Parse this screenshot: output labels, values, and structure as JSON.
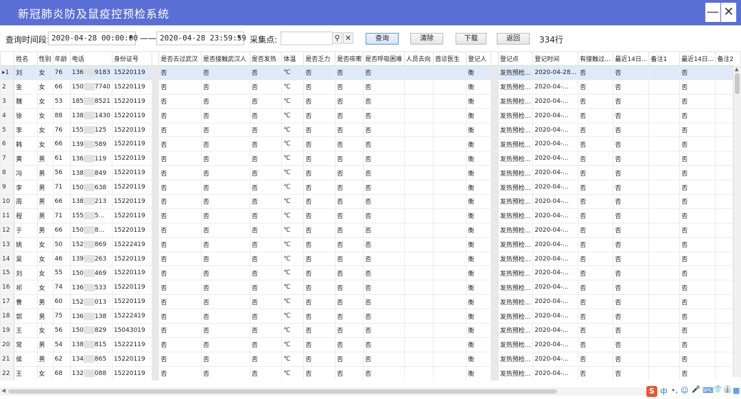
{
  "window": {
    "title": "新冠肺炎防及鼠疫控预检系统",
    "minimize_label": "—",
    "close_label": "✕"
  },
  "toolbar": {
    "time_label": "查询时间段:",
    "start_time": "2020-04-28 00:00:00",
    "separator": "——",
    "end_time": "2020-04-28 23:59:59",
    "site_label": "采集点:",
    "site_value": "",
    "query_label": "查询",
    "clear_label": "清除",
    "download_label": "下载",
    "back_label": "返回",
    "row_count": "334行"
  },
  "grid": {
    "columns": [
      "",
      "姓名",
      "性别",
      "年龄",
      "电话",
      "身份证号",
      "",
      "是否去过武汉",
      "是否接触武汉人",
      "是否发热",
      "体温",
      "是否乏力",
      "是否咳嗽",
      "是否呼吸困难",
      "人员去向",
      "首诊医生",
      "登记人",
      "",
      "登记点",
      "登记时间",
      "有接触过...",
      "最近14日...",
      "备注1",
      "最近14日...",
      "备注2"
    ],
    "rows": [
      {
        "n": "1",
        "name": "刘",
        "sex": "女",
        "age": "76",
        "phone": "136",
        "phone_tail": "9183",
        "id": "15220119",
        "wuhan": "否",
        "contact": "否",
        "fever": "否",
        "temp": "℃",
        "fatigue": "否",
        "cough": "否",
        "breath": "否",
        "reg": "衡",
        "site": "发热预检...",
        "time": "2020-04-28...",
        "c1": "否",
        "c2": "否",
        "c3": "否"
      },
      {
        "n": "2",
        "name": "金",
        "sex": "女",
        "age": "66",
        "phone": "150",
        "phone_tail": "7740",
        "id": "15220119",
        "wuhan": "否",
        "contact": "否",
        "fever": "否",
        "temp": "℃",
        "fatigue": "否",
        "cough": "否",
        "breath": "否",
        "reg": "衡",
        "site": "发热预检...",
        "time": "2020-04-...",
        "c1": "否",
        "c2": "否",
        "c3": "否"
      },
      {
        "n": "3",
        "name": "魏",
        "sex": "女",
        "age": "53",
        "phone": "185",
        "phone_tail": "8521",
        "id": "15220119",
        "wuhan": "否",
        "contact": "否",
        "fever": "否",
        "temp": "℃",
        "fatigue": "否",
        "cough": "否",
        "breath": "否",
        "reg": "衡",
        "site": "发热预检...",
        "time": "2020-04-...",
        "c1": "否",
        "c2": "否",
        "c3": "否"
      },
      {
        "n": "4",
        "name": "徐",
        "sex": "女",
        "age": "88",
        "phone": "138",
        "phone_tail": "1430",
        "id": "15220119",
        "wuhan": "否",
        "contact": "否",
        "fever": "否",
        "temp": "℃",
        "fatigue": "否",
        "cough": "否",
        "breath": "否",
        "reg": "衡",
        "site": "发热预检...",
        "time": "2020-04-...",
        "c1": "否",
        "c2": "否",
        "c3": "否"
      },
      {
        "n": "5",
        "name": "李",
        "sex": "女",
        "age": "76",
        "phone": "155",
        "phone_tail": "125",
        "id": "15220119",
        "wuhan": "否",
        "contact": "否",
        "fever": "否",
        "temp": "℃",
        "fatigue": "否",
        "cough": "否",
        "breath": "否",
        "reg": "衡",
        "site": "发热预检...",
        "time": "2020-04-...",
        "c1": "否",
        "c2": "否",
        "c3": "否"
      },
      {
        "n": "6",
        "name": "韩",
        "sex": "女",
        "age": "66",
        "phone": "139",
        "phone_tail": "589",
        "id": "15220119",
        "wuhan": "否",
        "contact": "否",
        "fever": "否",
        "temp": "℃",
        "fatigue": "否",
        "cough": "否",
        "breath": "否",
        "reg": "衡",
        "site": "发热预检...",
        "time": "2020-04-...",
        "c1": "否",
        "c2": "否",
        "c3": "否"
      },
      {
        "n": "7",
        "name": "黄",
        "sex": "男",
        "age": "61",
        "phone": "136",
        "phone_tail": "119",
        "id": "15220119",
        "wuhan": "否",
        "contact": "否",
        "fever": "否",
        "temp": "℃",
        "fatigue": "否",
        "cough": "否",
        "breath": "否",
        "reg": "衡",
        "site": "发热预检...",
        "time": "2020-04-...",
        "c1": "否",
        "c2": "否",
        "c3": "否"
      },
      {
        "n": "8",
        "name": "冯",
        "sex": "男",
        "age": "56",
        "phone": "138",
        "phone_tail": "849",
        "id": "15220119",
        "wuhan": "否",
        "contact": "否",
        "fever": "否",
        "temp": "℃",
        "fatigue": "否",
        "cough": "否",
        "breath": "否",
        "reg": "衡",
        "site": "发热预检...",
        "time": "2020-04-...",
        "c1": "否",
        "c2": "否",
        "c3": "否"
      },
      {
        "n": "9",
        "name": "李",
        "sex": "男",
        "age": "71",
        "phone": "150",
        "phone_tail": "638",
        "id": "15220119",
        "wuhan": "否",
        "contact": "否",
        "fever": "否",
        "temp": "℃",
        "fatigue": "否",
        "cough": "否",
        "breath": "否",
        "reg": "衡",
        "site": "发热预检...",
        "time": "2020-04-...",
        "c1": "否",
        "c2": "否",
        "c3": "否"
      },
      {
        "n": "10",
        "name": "周",
        "sex": "男",
        "age": "66",
        "phone": "138",
        "phone_tail": "213",
        "id": "15220119",
        "wuhan": "否",
        "contact": "否",
        "fever": "否",
        "temp": "℃",
        "fatigue": "否",
        "cough": "否",
        "breath": "否",
        "reg": "衡",
        "site": "发热预检...",
        "time": "2020-04-...",
        "c1": "否",
        "c2": "否",
        "c3": "否"
      },
      {
        "n": "11",
        "name": "程",
        "sex": "男",
        "age": "71",
        "phone": "155",
        "phone_tail": "5...",
        "id": "15220119",
        "wuhan": "否",
        "contact": "否",
        "fever": "否",
        "temp": "℃",
        "fatigue": "否",
        "cough": "否",
        "breath": "否",
        "reg": "衡",
        "site": "发热预检...",
        "time": "2020-04-...",
        "c1": "否",
        "c2": "否",
        "c3": "否"
      },
      {
        "n": "12",
        "name": "于",
        "sex": "男",
        "age": "66",
        "phone": "150",
        "phone_tail": "8...",
        "id": "15220119",
        "wuhan": "否",
        "contact": "否",
        "fever": "否",
        "temp": "℃",
        "fatigue": "否",
        "cough": "否",
        "breath": "否",
        "reg": "衡",
        "site": "发热预检...",
        "time": "2020-04-...",
        "c1": "否",
        "c2": "否",
        "c3": "否"
      },
      {
        "n": "13",
        "name": "姚",
        "sex": "女",
        "age": "50",
        "phone": "152",
        "phone_tail": "869",
        "id": "15222419",
        "wuhan": "否",
        "contact": "否",
        "fever": "否",
        "temp": "℃",
        "fatigue": "否",
        "cough": "否",
        "breath": "否",
        "reg": "衡",
        "site": "发热预检...",
        "time": "2020-04-...",
        "c1": "否",
        "c2": "否",
        "c3": "否"
      },
      {
        "n": "14",
        "name": "吴",
        "sex": "女",
        "age": "46",
        "phone": "139",
        "phone_tail": "263",
        "id": "15220119",
        "wuhan": "否",
        "contact": "否",
        "fever": "否",
        "temp": "℃",
        "fatigue": "否",
        "cough": "否",
        "breath": "否",
        "reg": "衡",
        "site": "发热预检...",
        "time": "2020-04-...",
        "c1": "否",
        "c2": "否",
        "c3": "否"
      },
      {
        "n": "15",
        "name": "刘",
        "sex": "女",
        "age": "55",
        "phone": "150",
        "phone_tail": "469",
        "id": "15220119",
        "wuhan": "否",
        "contact": "否",
        "fever": "否",
        "temp": "℃",
        "fatigue": "否",
        "cough": "否",
        "breath": "否",
        "reg": "衡",
        "site": "发热预检...",
        "time": "2020-04-...",
        "c1": "否",
        "c2": "否",
        "c3": "否"
      },
      {
        "n": "16",
        "name": "祁",
        "sex": "女",
        "age": "74",
        "phone": "136",
        "phone_tail": "533",
        "id": "15220119",
        "wuhan": "否",
        "contact": "否",
        "fever": "否",
        "temp": "℃",
        "fatigue": "否",
        "cough": "否",
        "breath": "否",
        "reg": "衡",
        "site": "发热预检...",
        "time": "2020-04-...",
        "c1": "否",
        "c2": "否",
        "c3": "否"
      },
      {
        "n": "17",
        "name": "曹",
        "sex": "男",
        "age": "60",
        "phone": "152",
        "phone_tail": "013",
        "id": "15220119",
        "wuhan": "否",
        "contact": "否",
        "fever": "否",
        "temp": "℃",
        "fatigue": "否",
        "cough": "否",
        "breath": "否",
        "reg": "衡",
        "site": "发热预检...",
        "time": "2020-04-...",
        "c1": "否",
        "c2": "否",
        "c3": "否"
      },
      {
        "n": "18",
        "name": "郭",
        "sex": "男",
        "age": "75",
        "phone": "136",
        "phone_tail": "138",
        "id": "15222419",
        "wuhan": "否",
        "contact": "否",
        "fever": "否",
        "temp": "℃",
        "fatigue": "否",
        "cough": "否",
        "breath": "否",
        "reg": "衡",
        "site": "发热预检...",
        "time": "2020-04-...",
        "c1": "否",
        "c2": "否",
        "c3": "否"
      },
      {
        "n": "19",
        "name": "王",
        "sex": "女",
        "age": "56",
        "phone": "150",
        "phone_tail": "829",
        "id": "15043019",
        "wuhan": "否",
        "contact": "否",
        "fever": "否",
        "temp": "℃",
        "fatigue": "否",
        "cough": "否",
        "breath": "否",
        "reg": "衡",
        "site": "发热预检...",
        "time": "2020-04-...",
        "c1": "否",
        "c2": "否",
        "c3": "否"
      },
      {
        "n": "20",
        "name": "常",
        "sex": "男",
        "age": "54",
        "phone": "138",
        "phone_tail": "815",
        "id": "15222119",
        "wuhan": "否",
        "contact": "否",
        "fever": "否",
        "temp": "℃",
        "fatigue": "否",
        "cough": "否",
        "breath": "否",
        "reg": "衡",
        "site": "发热预检...",
        "time": "2020-04-...",
        "c1": "否",
        "c2": "否",
        "c3": "否"
      },
      {
        "n": "21",
        "name": "侯",
        "sex": "男",
        "age": "62",
        "phone": "134",
        "phone_tail": "865",
        "id": "15220119",
        "wuhan": "否",
        "contact": "否",
        "fever": "否",
        "temp": "℃",
        "fatigue": "否",
        "cough": "否",
        "breath": "否",
        "reg": "衡",
        "site": "发热预检...",
        "time": "2020-04-...",
        "c1": "否",
        "c2": "否",
        "c3": "否"
      },
      {
        "n": "22",
        "name": "王",
        "sex": "女",
        "age": "68",
        "phone": "132",
        "phone_tail": "088",
        "id": "15220119",
        "wuhan": "否",
        "contact": "否",
        "fever": "否",
        "temp": "℃",
        "fatigue": "否",
        "cough": "否",
        "breath": "否",
        "reg": "衡",
        "site": "发热预检...",
        "time": "2020-04-...",
        "c1": "否",
        "c2": "否",
        "c3": "否"
      }
    ]
  },
  "tray": {
    "sogou": "S",
    "lang": "中",
    "dot": "•,",
    "emoji": "☺",
    "mic": "🎤",
    "keyboard": "⌨",
    "skin": "👕",
    "shirt": "👔",
    "grid": "▦"
  },
  "colors": {
    "titlebar": "#5a6fd6",
    "selected_row": "#dfe9f8"
  }
}
